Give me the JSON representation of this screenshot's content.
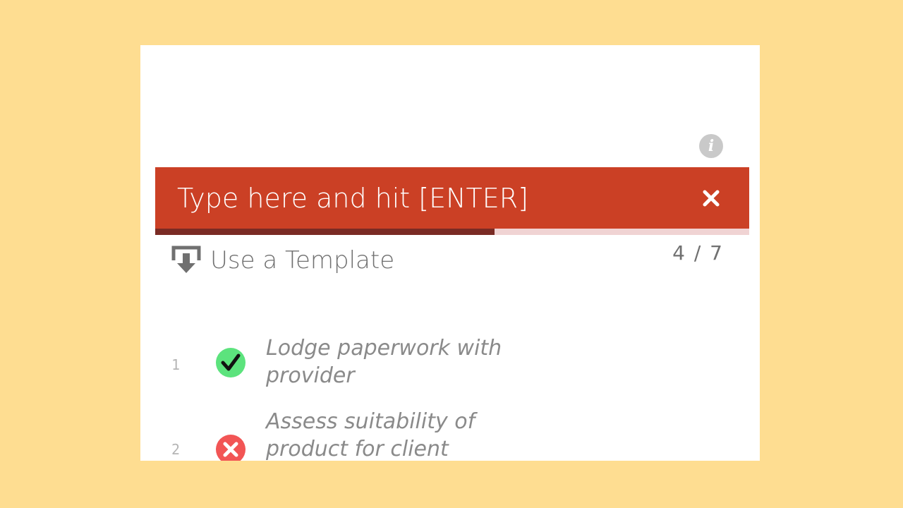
{
  "input": {
    "placeholder": "Type here and hit [ENTER]"
  },
  "progress": {
    "fraction": 0.571,
    "counter_text": "4 / 7"
  },
  "template_button": {
    "label": "Use a Template",
    "icon": "download-template-icon"
  },
  "info_button": {
    "icon": "info-icon",
    "glyph": "i"
  },
  "close_button": {
    "icon": "close-icon"
  },
  "tasks": [
    {
      "number": "1",
      "text": "Lodge paperwork with provider",
      "status": "done",
      "icon": "check-circle-icon"
    },
    {
      "number": "2",
      "text": "Assess suitability of product for client",
      "status": "rejected",
      "icon": "x-circle-icon"
    }
  ],
  "colors": {
    "background": "#fedd91",
    "accent": "#cb4025",
    "progress_fill": "#7a2b24",
    "done": "#5ce37d",
    "rejected": "#f25555"
  }
}
